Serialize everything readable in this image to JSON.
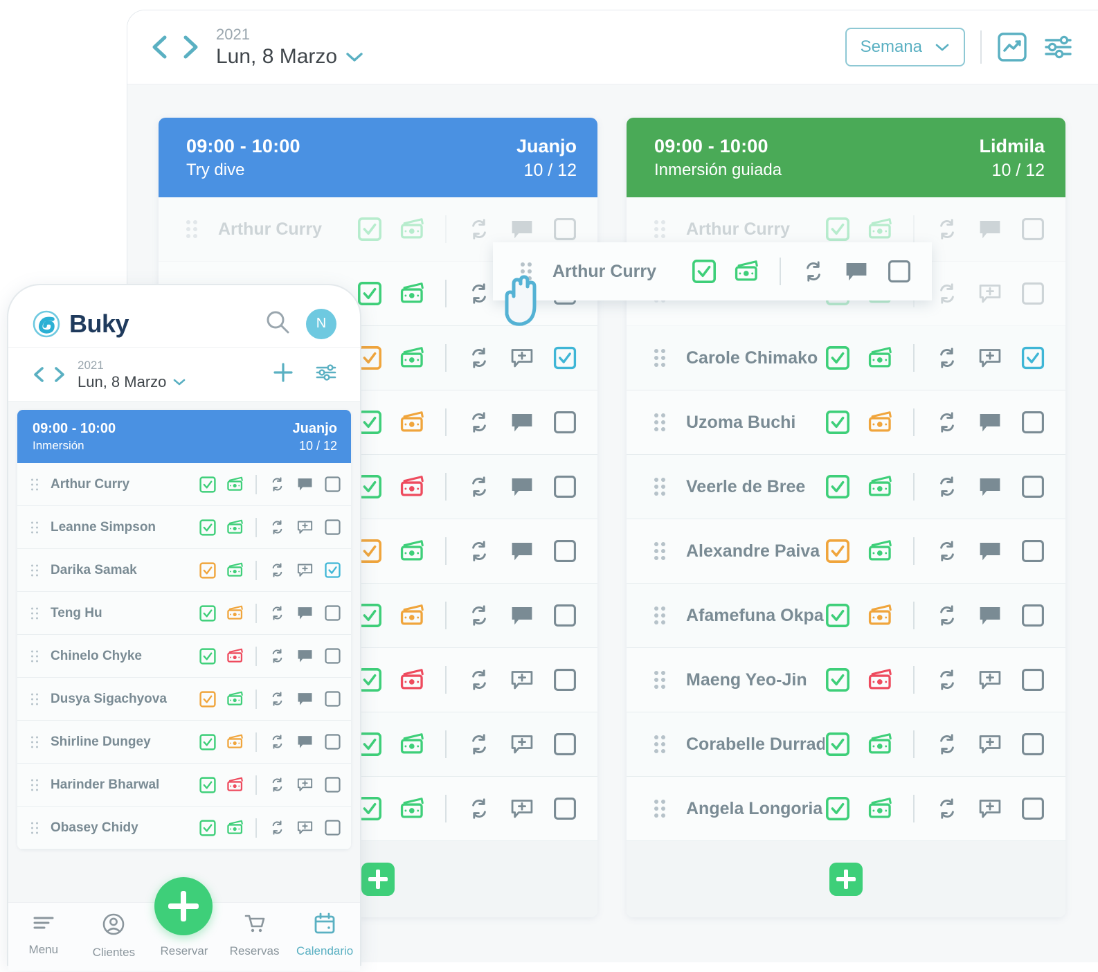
{
  "desktop": {
    "topbar": {
      "year": "2021",
      "date": "Lun, 8 Marzo",
      "view_selector": "Semana",
      "prev_icon": "chevron-left-icon",
      "next_icon": "chevron-right-icon",
      "caret_icon": "chevron-down-icon",
      "stats_icon": "activity-chart-icon",
      "filters_icon": "sliders-icon"
    },
    "cards": [
      {
        "color": "#4a91e2",
        "time": "09:00 - 10:00",
        "activity": "Try dive",
        "instructor": "Juanjo",
        "count": "10 / 12",
        "add_label": "+",
        "participants": [
          {
            "name": "Arthur Curry",
            "dimmed": true,
            "check": "green",
            "money": "green",
            "repeat": "gray",
            "note": "filled",
            "select": "empty"
          },
          {
            "name": "",
            "dimmed": false,
            "check": "green",
            "money": "green",
            "repeat": "gray",
            "note": "plus",
            "select": "empty"
          },
          {
            "name": "",
            "dimmed": false,
            "check": "orange",
            "money": "green",
            "repeat": "gray",
            "note": "plus",
            "select": "checked"
          },
          {
            "name": "",
            "dimmed": false,
            "check": "green",
            "money": "orange",
            "repeat": "gray",
            "note": "filled",
            "select": "empty"
          },
          {
            "name": "",
            "dimmed": false,
            "check": "green",
            "money": "red",
            "repeat": "gray",
            "note": "filled",
            "select": "empty"
          },
          {
            "name": "",
            "dimmed": false,
            "check": "orange",
            "money": "green",
            "repeat": "gray",
            "note": "filled",
            "select": "empty"
          },
          {
            "name": "",
            "dimmed": false,
            "check": "green",
            "money": "orange",
            "repeat": "gray",
            "note": "filled",
            "select": "empty"
          },
          {
            "name": "",
            "dimmed": false,
            "check": "green",
            "money": "red",
            "repeat": "gray",
            "note": "plus",
            "select": "empty"
          },
          {
            "name": "",
            "dimmed": false,
            "check": "green",
            "money": "green",
            "repeat": "gray",
            "note": "plus",
            "select": "empty"
          },
          {
            "name": "",
            "dimmed": false,
            "check": "green",
            "money": "green",
            "repeat": "gray",
            "note": "plus",
            "select": "empty"
          }
        ]
      },
      {
        "color": "#4aaa57",
        "time": "09:00 - 10:00",
        "activity": "Inmersión guiada",
        "instructor": "Lidmila",
        "count": "10 / 12",
        "add_label": "+",
        "participants": [
          {
            "name": "Arthur Curry",
            "dimmed": true,
            "check": "green",
            "money": "green",
            "repeat": "gray",
            "note": "filled",
            "select": "empty"
          },
          {
            "name": "",
            "dimmed": true,
            "check": "green",
            "money": "green",
            "repeat": "gray",
            "note": "plus",
            "select": "empty"
          },
          {
            "name": "Carole Chimako",
            "dimmed": false,
            "check": "green",
            "money": "green",
            "repeat": "gray",
            "note": "plus",
            "select": "checked"
          },
          {
            "name": "Uzoma Buchi",
            "dimmed": false,
            "check": "green",
            "money": "orange",
            "repeat": "gray",
            "note": "filled",
            "select": "empty"
          },
          {
            "name": "Veerle de Bree",
            "dimmed": false,
            "check": "green",
            "money": "green",
            "repeat": "gray",
            "note": "filled",
            "select": "empty"
          },
          {
            "name": "Alexandre Paiva",
            "dimmed": false,
            "check": "orange",
            "money": "green",
            "repeat": "gray",
            "note": "filled",
            "select": "empty"
          },
          {
            "name": "Afamefuna Okparo",
            "dimmed": false,
            "check": "green",
            "money": "orange",
            "repeat": "gray",
            "note": "filled",
            "select": "empty"
          },
          {
            "name": "Maeng Yeo-Jin",
            "dimmed": false,
            "check": "green",
            "money": "red",
            "repeat": "gray",
            "note": "plus",
            "select": "empty"
          },
          {
            "name": "Corabelle Durrad",
            "dimmed": false,
            "check": "green",
            "money": "green",
            "repeat": "gray",
            "note": "plus",
            "select": "empty"
          },
          {
            "name": "Angela Longoria",
            "dimmed": false,
            "check": "green",
            "money": "green",
            "repeat": "gray",
            "note": "plus",
            "select": "empty"
          }
        ]
      }
    ],
    "drag_row": {
      "name": "Arthur Curry",
      "check": "green",
      "money": "green",
      "repeat": "gray",
      "note": "filled",
      "select": "empty"
    }
  },
  "mobile": {
    "brand": "Buky",
    "search_icon": "search-icon",
    "avatar_initial": "N",
    "datebar": {
      "year": "2021",
      "date": "Lun, 8 Marzo",
      "add_icon": "plus-icon",
      "filters_icon": "sliders-icon"
    },
    "card": {
      "time": "09:00 - 10:00",
      "activity": "Inmersión",
      "instructor": "Juanjo",
      "count": "10 / 12",
      "participants": [
        {
          "name": "Arthur Curry",
          "check": "green",
          "money": "green",
          "repeat": "gray",
          "note": "filled",
          "select": "empty"
        },
        {
          "name": "Leanne Simpson",
          "check": "green",
          "money": "green",
          "repeat": "gray",
          "note": "plus",
          "select": "empty"
        },
        {
          "name": "Darika Samak",
          "check": "orange",
          "money": "green",
          "repeat": "gray",
          "note": "plus",
          "select": "checked"
        },
        {
          "name": "Teng Hu",
          "check": "green",
          "money": "orange",
          "repeat": "gray",
          "note": "filled",
          "select": "empty"
        },
        {
          "name": "Chinelo Chyke",
          "check": "green",
          "money": "red",
          "repeat": "gray",
          "note": "filled",
          "select": "empty"
        },
        {
          "name": "Dusya Sigachyova",
          "check": "orange",
          "money": "green",
          "repeat": "gray",
          "note": "filled",
          "select": "empty"
        },
        {
          "name": "Shirline Dungey",
          "check": "green",
          "money": "orange",
          "repeat": "gray",
          "note": "filled",
          "select": "empty"
        },
        {
          "name": "Harinder Bharwal",
          "check": "green",
          "money": "red",
          "repeat": "gray",
          "note": "plus",
          "select": "empty"
        },
        {
          "name": "Obasey Chidy",
          "check": "green",
          "money": "green",
          "repeat": "gray",
          "note": "plus",
          "select": "empty"
        }
      ]
    },
    "fab_icon": "plus-icon",
    "tabs": [
      {
        "label": "Menu",
        "icon": "menu-icon",
        "active": false
      },
      {
        "label": "Clientes",
        "icon": "user-icon",
        "active": false
      },
      {
        "label": "Reservar",
        "icon": "blank-icon",
        "active": false
      },
      {
        "label": "Reservas",
        "icon": "cart-icon",
        "active": false
      },
      {
        "label": "Calendario",
        "icon": "calendar-icon",
        "active": true
      }
    ]
  },
  "colors": {
    "blue": "#4a91e2",
    "green": "#4aaa57",
    "teal": "#5ab0c2",
    "accent_green": "#3ecf79",
    "orange": "#f0a53c",
    "red": "#ee4b5e",
    "gray": "#7a8b94"
  }
}
